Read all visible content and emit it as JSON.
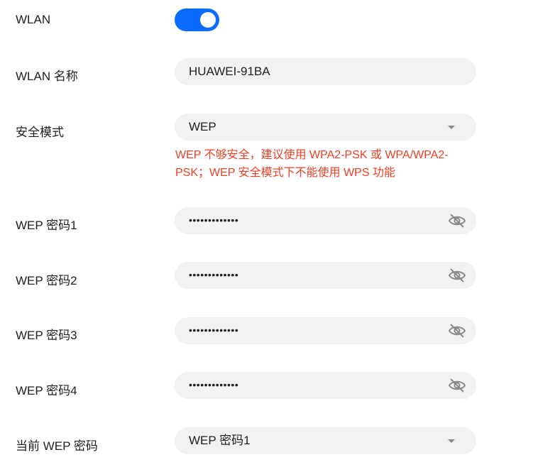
{
  "wlan": {
    "label": "WLAN",
    "enabled": true
  },
  "ssid": {
    "label": "WLAN 名称",
    "value": "HUAWEI-91BA"
  },
  "security": {
    "label": "安全模式",
    "value": "WEP",
    "warning": "WEP 不够安全，建议使用 WPA2-PSK 或 WPA/WPA2-PSK；WEP 安全模式下不能使用 WPS 功能"
  },
  "wep_keys": [
    {
      "label": "WEP 密码1",
      "value": "•••••••••••••"
    },
    {
      "label": "WEP 密码2",
      "value": "•••••••••••••"
    },
    {
      "label": "WEP 密码3",
      "value": "•••••••••••••"
    },
    {
      "label": "WEP 密码4",
      "value": "•••••••••••••"
    }
  ],
  "current_key": {
    "label": "当前 WEP 密码",
    "value": "WEP 密码1"
  },
  "icons": {
    "password_visibility": "eye-off-icon",
    "dropdown": "chevron-down-icon"
  },
  "colors": {
    "accent": "#0a6cff",
    "warning": "#e84026",
    "field_bg": "#f2f2f2"
  }
}
